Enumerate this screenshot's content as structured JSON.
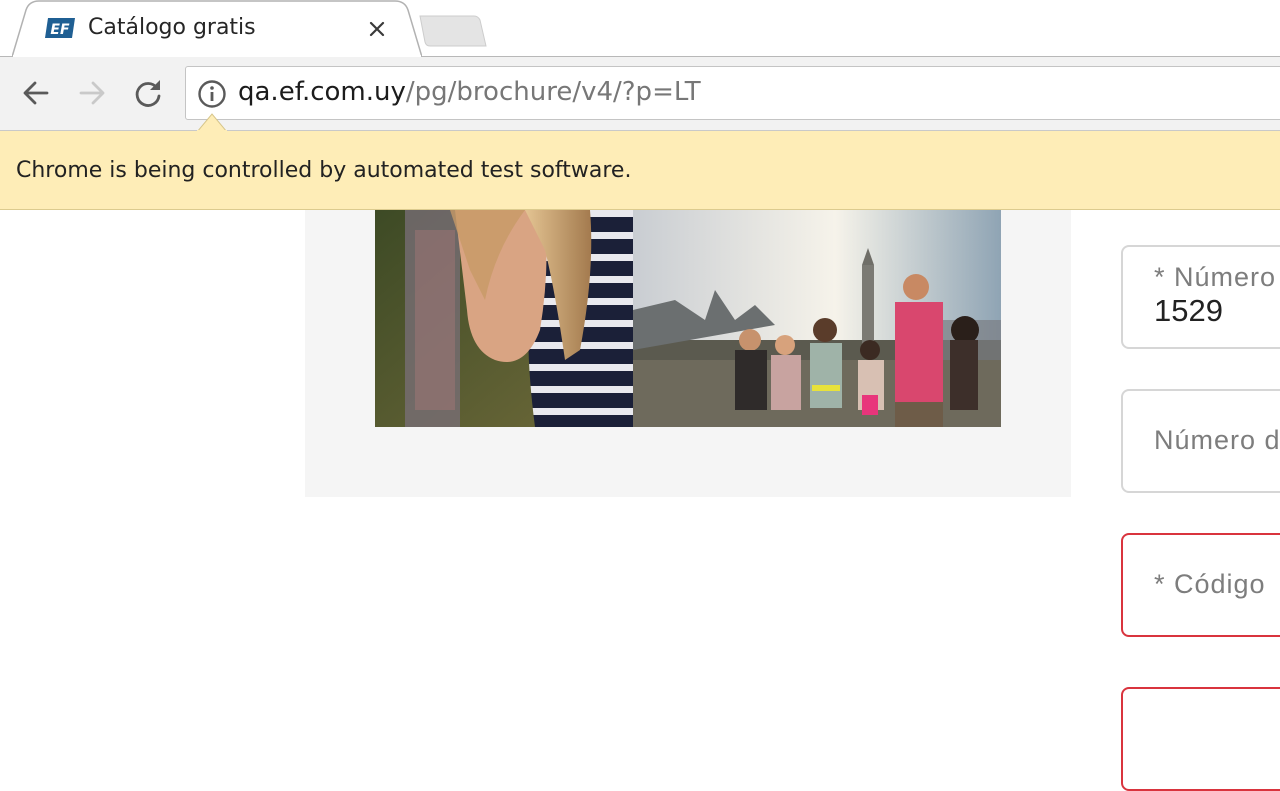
{
  "browser": {
    "tab": {
      "title": "Catálogo gratis",
      "favicon": "ef-logo-icon",
      "favicon_text": "EF"
    },
    "address_bar": {
      "host": "qa.ef.com.uy",
      "path": "/pg/brochure/v4/?p=LT"
    },
    "infobar": {
      "message": "Chrome is being controlled by automated test software."
    }
  },
  "form": {
    "fields": [
      {
        "label": "* Número",
        "value": "1529",
        "state": "normal"
      },
      {
        "label": "Número d",
        "value": "",
        "state": "normal"
      },
      {
        "label": "* Código",
        "value": "",
        "state": "error"
      },
      {
        "label": "",
        "value": "",
        "state": "error"
      }
    ]
  },
  "colors": {
    "infobar_bg": "#feedb7",
    "error_border": "#d9343e",
    "field_border": "#d6d6d6",
    "toolbar_bg": "#f2f2f2"
  }
}
